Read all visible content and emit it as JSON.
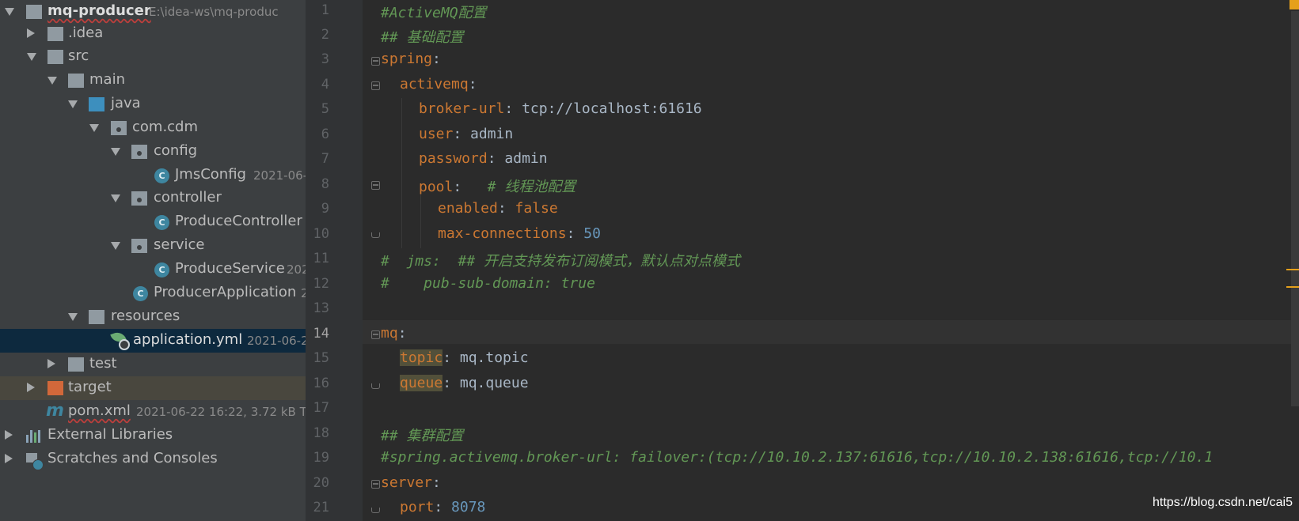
{
  "project_tree": {
    "items": [
      {
        "label": "mq-producer",
        "meta": "E:\\idea-ws\\mq-produc"
      },
      {
        "label": ".idea"
      },
      {
        "label": "src"
      },
      {
        "label": "main"
      },
      {
        "label": "java"
      },
      {
        "label": "com.cdm"
      },
      {
        "label": "config"
      },
      {
        "label": "JmsConfig",
        "meta": "2021-06-"
      },
      {
        "label": "controller"
      },
      {
        "label": "ProduceController"
      },
      {
        "label": "service"
      },
      {
        "label": "ProduceService",
        "meta": "202"
      },
      {
        "label": "ProducerApplication",
        "meta": "2"
      },
      {
        "label": "resources"
      },
      {
        "label": "application.yml",
        "meta": "2021-06-2"
      },
      {
        "label": "test"
      },
      {
        "label": "target"
      },
      {
        "label": "pom.xml",
        "meta": "2021-06-22 16:22, 3.72 kB To"
      },
      {
        "label": "External Libraries"
      },
      {
        "label": "Scratches and Consoles"
      }
    ],
    "selected_item": "application.yml"
  },
  "editor": {
    "current_line": "14",
    "lines": [
      {
        "no": "1",
        "text": "#ActiveMQ配置"
      },
      {
        "no": "2",
        "text": "## 基础配置"
      },
      {
        "no": "3",
        "key": "spring",
        "sep": ":"
      },
      {
        "no": "4",
        "key": "activemq",
        "sep": ":"
      },
      {
        "no": "5",
        "key": "broker-url",
        "sep": ": ",
        "value": "tcp://localhost:61616"
      },
      {
        "no": "6",
        "key": "user",
        "sep": ": ",
        "value": "admin"
      },
      {
        "no": "7",
        "key": "password",
        "sep": ": ",
        "value": "admin"
      },
      {
        "no": "8",
        "key": "pool",
        "sep": ":   ",
        "comment": "# 线程池配置"
      },
      {
        "no": "9",
        "key": "enabled",
        "sep": ": ",
        "value": "false"
      },
      {
        "no": "10",
        "key": "max-connections",
        "sep": ": ",
        "value": "50"
      },
      {
        "no": "11",
        "text": "#  jms:  ## 开启支持发布订阅模式，默认点对点模式"
      },
      {
        "no": "12",
        "text": "#    pub-sub-domain: true"
      },
      {
        "no": "13",
        "text": ""
      },
      {
        "no": "14",
        "key": "mq",
        "sep": ":"
      },
      {
        "no": "15",
        "key": "topic",
        "sep": ": ",
        "value": "mq.topic"
      },
      {
        "no": "16",
        "key": "queue",
        "sep": ": ",
        "value": "mq.queue"
      },
      {
        "no": "17",
        "text": ""
      },
      {
        "no": "18",
        "text": "## 集群配置"
      },
      {
        "no": "19",
        "text": "#spring.activemq.broker-url: failover:(tcp://10.10.2.137:61616,tcp://10.10.2.138:61616,tcp://10.1"
      },
      {
        "no": "20",
        "key": "server",
        "sep": ":"
      },
      {
        "no": "21",
        "key": "port",
        "sep": ": ",
        "value": "8078"
      }
    ]
  },
  "watermark": "https://blog.csdn.net/cai5",
  "colors": {
    "keyword": "#cc7832",
    "comment": "#629755",
    "number": "#6897bb",
    "text": "#a9b7c6",
    "selection": "#0d293e"
  }
}
